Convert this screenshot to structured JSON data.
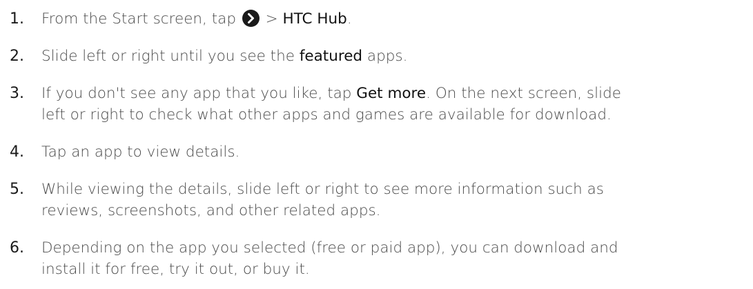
{
  "steps": [
    {
      "num": "1.",
      "t1": "From the Start screen, tap ",
      "t2": " > ",
      "b1": "HTC Hub",
      "t3": ".",
      "icon": "right-arrow-circle-icon"
    },
    {
      "num": "2.",
      "t1": "Slide left or right until you see the ",
      "b1": "featured",
      "t2": " apps."
    },
    {
      "num": "3.",
      "t1": "If you don't see any app that you like, tap ",
      "b1": "Get more",
      "t2": ". On the next screen, slide",
      "line2": "left or right to check what other apps and games are available for download."
    },
    {
      "num": "4.",
      "t1": "Tap an app to view details."
    },
    {
      "num": "5.",
      "line1": "While viewing the details, slide left or right to see more information such as",
      "line2": "reviews, screenshots, and other related apps."
    },
    {
      "num": "6.",
      "line1": "Depending on the app you selected (free or paid app), you can download and",
      "line2": "install it for free, try it out, or buy it."
    }
  ]
}
